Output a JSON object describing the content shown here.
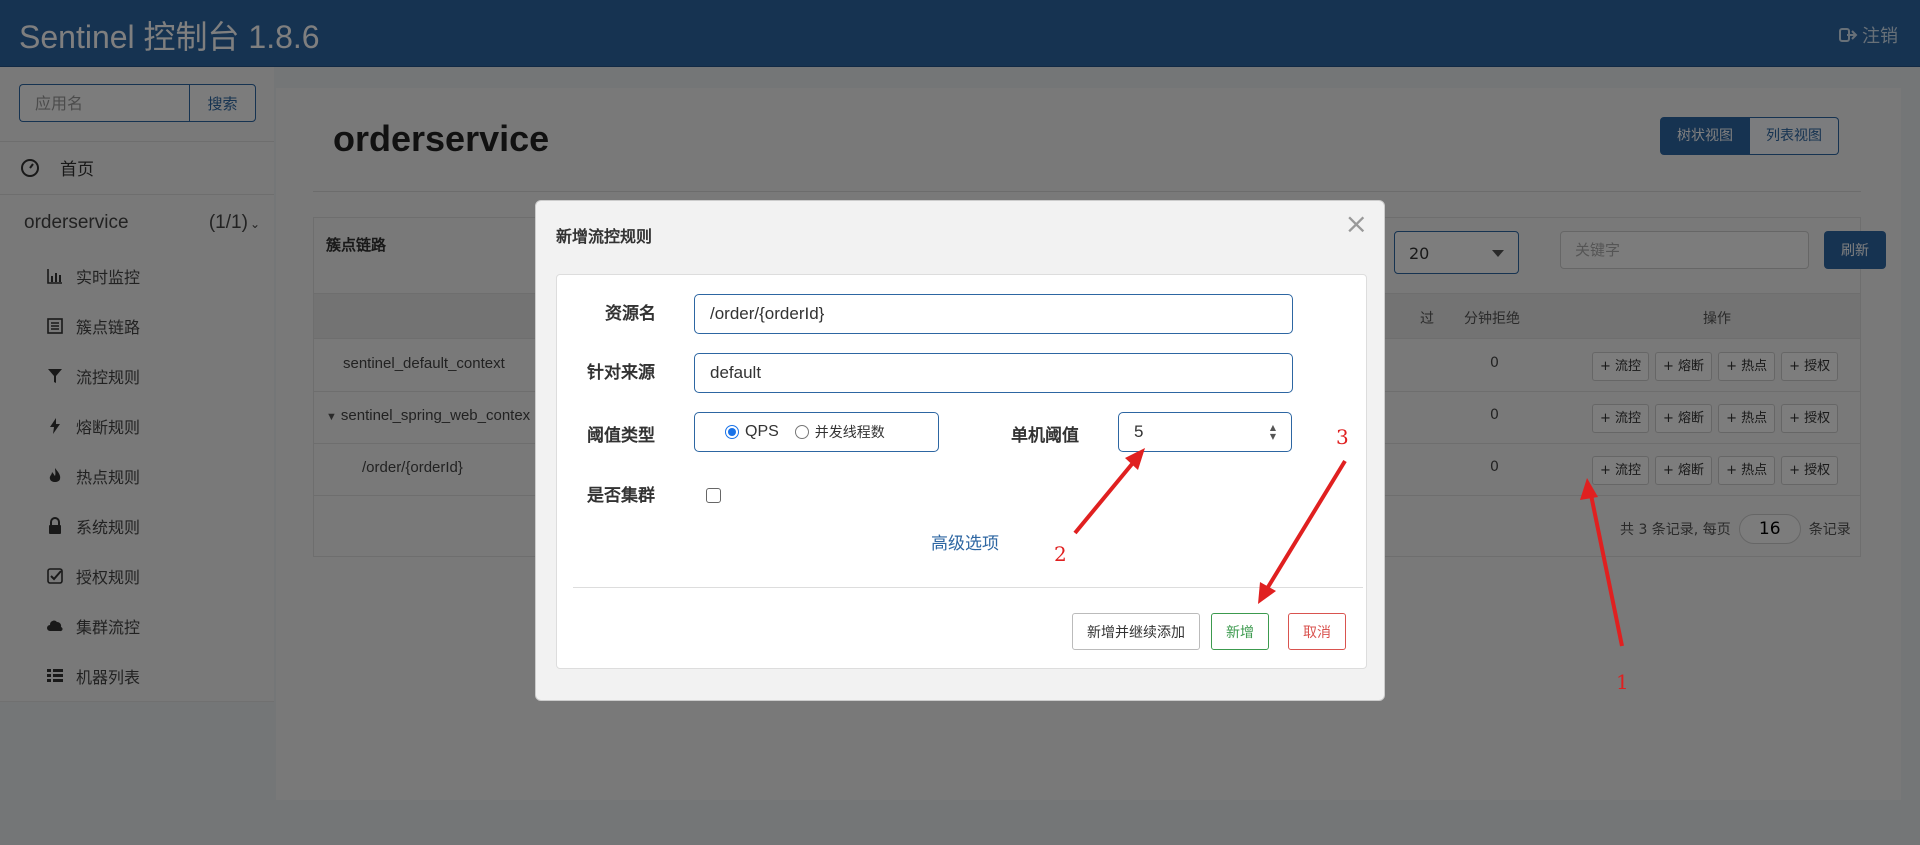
{
  "header": {
    "title": "Sentinel 控制台 1.8.6",
    "logout_label": "注销"
  },
  "sidebar": {
    "search_placeholder": "应用名",
    "search_button": "搜索",
    "home_label": "首页",
    "app": {
      "name": "orderservice",
      "count": "(1/1)"
    },
    "items": [
      {
        "label": "实时监控",
        "icon": "bar-chart-icon"
      },
      {
        "label": "簇点链路",
        "icon": "list-icon"
      },
      {
        "label": "流控规则",
        "icon": "filter-icon"
      },
      {
        "label": "熔断规则",
        "icon": "bolt-icon"
      },
      {
        "label": "热点规则",
        "icon": "fire-icon"
      },
      {
        "label": "系统规则",
        "icon": "lock-icon"
      },
      {
        "label": "授权规则",
        "icon": "check-square-icon"
      },
      {
        "label": "集群流控",
        "icon": "cloud-icon"
      },
      {
        "label": "机器列表",
        "icon": "th-list-icon"
      }
    ]
  },
  "main": {
    "title": "orderservice",
    "view_tree": "树状视图",
    "view_list": "列表视图",
    "panel_title": "簇点链路",
    "page_size": "20",
    "keyword_placeholder": "关键字",
    "refresh": "刷新",
    "columns": {
      "pass_partial": "过",
      "minute_block": "分钟拒绝",
      "ops": "操作"
    },
    "ops": [
      "+ 流控",
      "+ 熔断",
      "+ 热点",
      "+ 授权"
    ],
    "rows": [
      {
        "resource": "sentinel_default_context",
        "minute_block": "0"
      },
      {
        "resource": "sentinel_spring_web_contex",
        "minute_block": "0"
      },
      {
        "resource": "/order/{orderId}",
        "minute_block": "0"
      }
    ],
    "pager": {
      "prefix": "共 3 条记录, 每页",
      "per_page": "16",
      "suffix": "条记录"
    }
  },
  "modal": {
    "title": "新增流控规则",
    "close": "×",
    "resource_label": "资源名",
    "resource_value": "/order/{orderId}",
    "source_label": "针对来源",
    "source_value": "default",
    "threshold_type_label": "阈值类型",
    "qps_label": "QPS",
    "thread_label": "并发线程数",
    "single_threshold_label": "单机阈值",
    "single_threshold_value": "5",
    "cluster_label": "是否集群",
    "advanced_link": "高级选项",
    "btn_add_continue": "新增并继续添加",
    "btn_add": "新增",
    "btn_cancel": "取消"
  },
  "annotations": {
    "n1": "1",
    "n2": "2",
    "n3": "3",
    "color": "#e02020"
  }
}
